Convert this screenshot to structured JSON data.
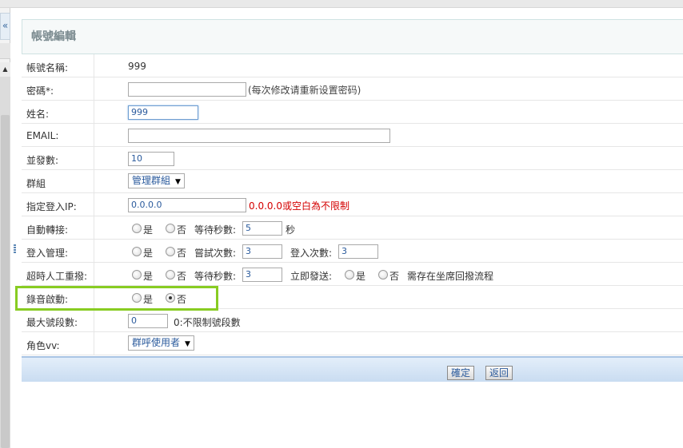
{
  "header": {
    "title": "帳號編輯"
  },
  "left_pane": {
    "collapse_glyph": "«",
    "scroll_up_glyph": "▲"
  },
  "form": {
    "account": {
      "label": "帳號名稱:",
      "value": "999"
    },
    "password": {
      "label": "密碼*:",
      "value": "",
      "hint": "(每次修改请重新设置密码)"
    },
    "name": {
      "label": "姓名:",
      "value": "999"
    },
    "email": {
      "label": "EMAIL:",
      "value": ""
    },
    "concurrency": {
      "label": "並發數:",
      "value": "10"
    },
    "group": {
      "label": "群組",
      "selected": "管理群組"
    },
    "login_ip": {
      "label": "指定登入IP:",
      "value": "0.0.0.0",
      "hint": "0.0.0.0或空白為不限制"
    },
    "auto_transfer": {
      "label": "自動轉接:",
      "yes": "是",
      "no": "否",
      "wait_label": "等待秒數:",
      "wait_value": "5",
      "unit": "秒"
    },
    "login_mgmt": {
      "label": "登入管理:",
      "yes": "是",
      "no": "否",
      "attempts_label": "嘗試次數:",
      "attempts_value": "3",
      "login_count_label": "登入次數:",
      "login_count_value": "3"
    },
    "timeout_redial": {
      "label": "超時人工重撥:",
      "yes": "是",
      "no": "否",
      "wait_label": "等待秒數:",
      "wait_value": "3",
      "send_now_label": "立即發送:",
      "send_yes": "是",
      "send_no": "否",
      "hint": "需存在坐席回撥流程"
    },
    "recording": {
      "label": "錄音啟動:",
      "yes": "是",
      "no": "否",
      "selected": "no"
    },
    "max_segments": {
      "label": "最大號段數:",
      "value": "0",
      "hint": "0:不限制號段數"
    },
    "role": {
      "label": "角色vv:",
      "selected": "群呼使用者"
    }
  },
  "footer": {
    "confirm_label": "確定",
    "back_label": "返回"
  },
  "colors": {
    "accent_green": "#88cc22",
    "hint_red": "#d40000",
    "footer_blue": "#c9dcf1"
  }
}
